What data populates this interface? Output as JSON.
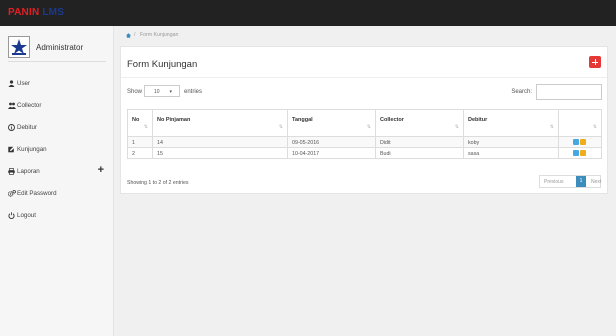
{
  "brand": {
    "part1": "PANIN",
    "part2": "LMS"
  },
  "colors": {
    "accent": "#3c8dbc",
    "danger": "#e53935",
    "edit": "#45a8e0",
    "delete": "#f0ad1b"
  },
  "profile": {
    "name": "Administrator"
  },
  "menu": [
    {
      "id": "user",
      "label": "User",
      "icon": "user-icon"
    },
    {
      "id": "collector",
      "label": "Collector",
      "icon": "users-icon"
    },
    {
      "id": "debitur",
      "label": "Debitur",
      "icon": "info-circle-icon"
    },
    {
      "id": "kunjungan",
      "label": "Kunjungan",
      "icon": "edit-icon"
    },
    {
      "id": "laporan",
      "label": "Laporan",
      "icon": "print-icon",
      "expander": "+"
    },
    {
      "id": "edit-password",
      "label": "Edit Password",
      "icon": "gears-icon"
    },
    {
      "id": "logout",
      "label": "Logout",
      "icon": "power-icon"
    }
  ],
  "breadcrumb": {
    "separator": "/",
    "current": "Form Kunjungan"
  },
  "panel": {
    "title": "Form Kunjungan"
  },
  "table_controls": {
    "show_label": "Show",
    "entries_value": "10",
    "entries_label": "entries",
    "search_label": "Search:"
  },
  "table": {
    "headers": [
      "No",
      "No Pinjaman",
      "Tanggal",
      "Collector",
      "Debitur",
      ""
    ],
    "rows": [
      [
        "1",
        "14",
        "09-05-2016",
        "Didit",
        "koby"
      ],
      [
        "2",
        "15",
        "10-04-2017",
        "Budi",
        "sasa"
      ]
    ]
  },
  "footer": {
    "info": "Showing 1 to 2 of 2 entries",
    "prev": "Previous",
    "page": "1",
    "next": "Next"
  }
}
